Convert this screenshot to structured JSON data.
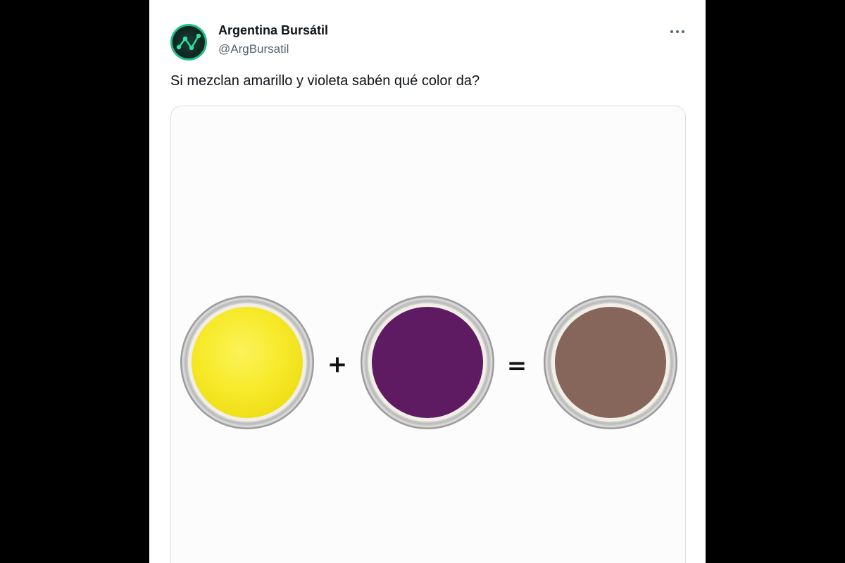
{
  "tweet": {
    "author_name": "Argentina Bursátil",
    "author_handle": "@ArgBursatil",
    "text": "Si mezclan amarillo y violeta sabén qué color da?",
    "avatar_icon": "chart-line-icon",
    "more_icon": "more-horizontal-icon"
  },
  "image": {
    "plus_sign": "+",
    "equals_sign": "=",
    "colors": {
      "yellow": "#f7ea2a",
      "violet": "#5e1b62",
      "brown": "#86665a"
    }
  },
  "colors": {
    "accent": "#1fbf85",
    "secondary_text": "#536471"
  }
}
